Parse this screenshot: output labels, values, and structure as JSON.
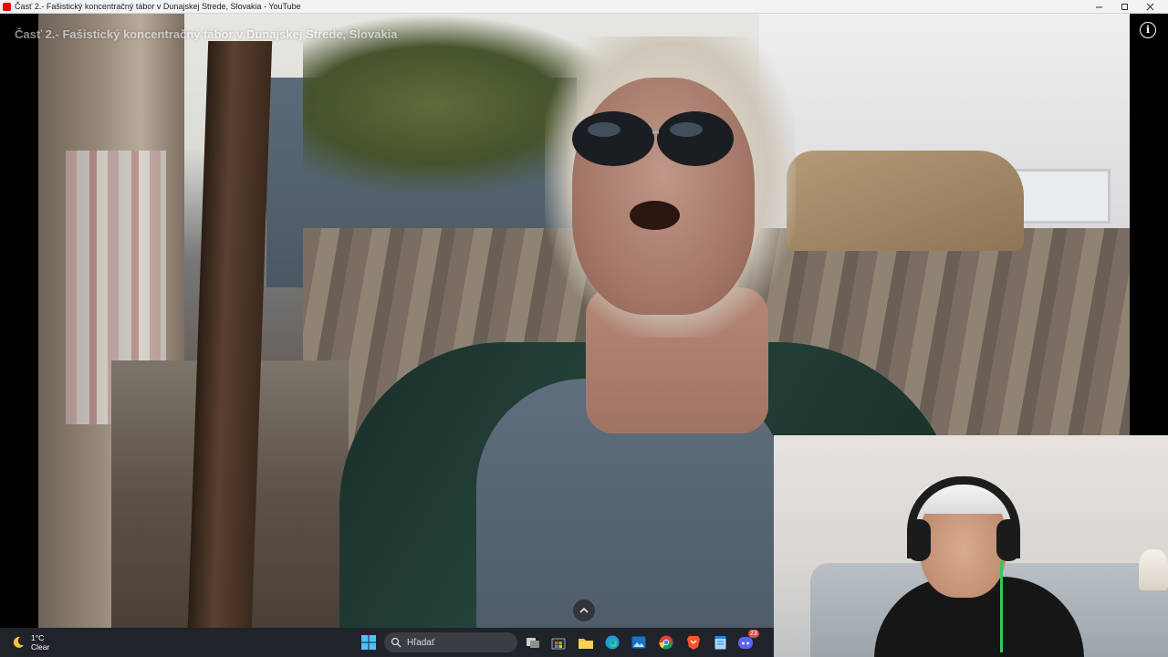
{
  "window": {
    "title": "Časť 2.- Fašistický koncentračný tábor v Dunajskej Strede, Slovakia - YouTube",
    "controls": [
      "minimize",
      "maximize",
      "close"
    ]
  },
  "player": {
    "video_title": "Časť 2.- Fašistický koncentračný tábor v Dunajskej Strede, Slovakia",
    "info_icon": "info-icon",
    "info_glyph": "i",
    "expand_icon": "chevron-up-icon"
  },
  "taskbar": {
    "weather": {
      "temperature": "1°C",
      "condition": "Clear",
      "icon": "moon-icon"
    },
    "search_placeholder": "Hľadať",
    "pinned_apps": [
      "windows-start-icon",
      "task-view-icon",
      "store-icon",
      "file-explorer-icon",
      "edge-icon",
      "photos-icon",
      "chrome-icon",
      "brave-icon",
      "notepad-icon",
      "discord-icon"
    ],
    "discord_badge": "23"
  }
}
